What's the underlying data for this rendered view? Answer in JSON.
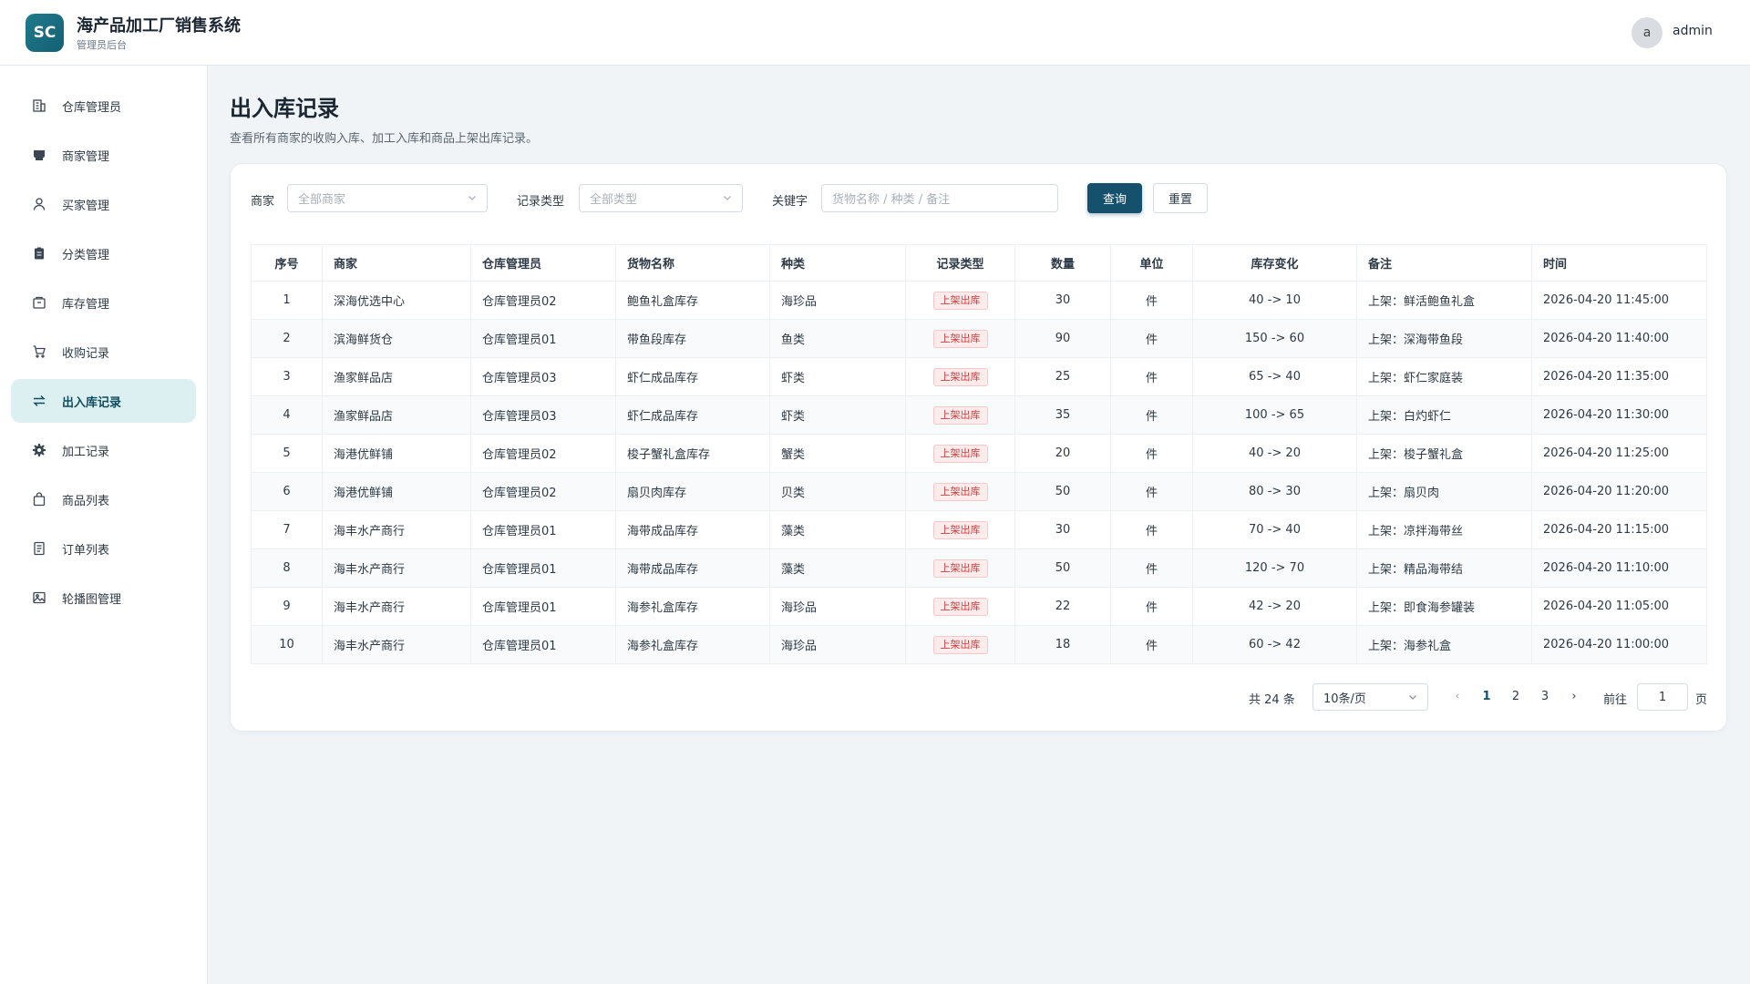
{
  "header": {
    "logo_text": "SC",
    "title": "海产品加工厂销售系统",
    "subtitle": "管理员后台",
    "avatar_letter": "a",
    "username": "admin"
  },
  "sidebar": {
    "items": [
      {
        "label": "仓库管理员",
        "icon": "building-icon"
      },
      {
        "label": "商家管理",
        "icon": "store-icon"
      },
      {
        "label": "买家管理",
        "icon": "user-icon"
      },
      {
        "label": "分类管理",
        "icon": "clipboard-icon"
      },
      {
        "label": "库存管理",
        "icon": "package-icon"
      },
      {
        "label": "收购记录",
        "icon": "cart-icon"
      },
      {
        "label": "出入库记录",
        "icon": "transfer-icon",
        "active": true
      },
      {
        "label": "加工记录",
        "icon": "gear-icon"
      },
      {
        "label": "商品列表",
        "icon": "bag-icon"
      },
      {
        "label": "订单列表",
        "icon": "document-icon"
      },
      {
        "label": "轮播图管理",
        "icon": "image-icon"
      }
    ]
  },
  "main": {
    "title": "出入库记录",
    "description": "查看所有商家的收购入库、加工入库和商品上架出库记录。"
  },
  "filters": {
    "merchant_label": "商家",
    "merchant_placeholder": "全部商家",
    "type_label": "记录类型",
    "type_placeholder": "全部类型",
    "keyword_label": "关键字",
    "keyword_placeholder": "货物名称 / 种类 / 备注",
    "search_button": "查询",
    "reset_button": "重置"
  },
  "table": {
    "columns": [
      "序号",
      "商家",
      "仓库管理员",
      "货物名称",
      "种类",
      "记录类型",
      "数量",
      "单位",
      "库存变化",
      "备注",
      "时间"
    ],
    "rows": [
      [
        "1",
        "深海优选中心",
        "仓库管理员02",
        "鲍鱼礼盒库存",
        "海珍品",
        "上架出库",
        "30",
        "件",
        "40 -> 10",
        "上架：鲜活鲍鱼礼盒",
        "2026-04-20 11:45:00"
      ],
      [
        "2",
        "滨海鲜货仓",
        "仓库管理员01",
        "带鱼段库存",
        "鱼类",
        "上架出库",
        "90",
        "件",
        "150 -> 60",
        "上架：深海带鱼段",
        "2026-04-20 11:40:00"
      ],
      [
        "3",
        "渔家鲜品店",
        "仓库管理员03",
        "虾仁成品库存",
        "虾类",
        "上架出库",
        "25",
        "件",
        "65 -> 40",
        "上架：虾仁家庭装",
        "2026-04-20 11:35:00"
      ],
      [
        "4",
        "渔家鲜品店",
        "仓库管理员03",
        "虾仁成品库存",
        "虾类",
        "上架出库",
        "35",
        "件",
        "100 -> 65",
        "上架：白灼虾仁",
        "2026-04-20 11:30:00"
      ],
      [
        "5",
        "海港优鲜铺",
        "仓库管理员02",
        "梭子蟹礼盒库存",
        "蟹类",
        "上架出库",
        "20",
        "件",
        "40 -> 20",
        "上架：梭子蟹礼盒",
        "2026-04-20 11:25:00"
      ],
      [
        "6",
        "海港优鲜铺",
        "仓库管理员02",
        "扇贝肉库存",
        "贝类",
        "上架出库",
        "50",
        "件",
        "80 -> 30",
        "上架：扇贝肉",
        "2026-04-20 11:20:00"
      ],
      [
        "7",
        "海丰水产商行",
        "仓库管理员01",
        "海带成品库存",
        "藻类",
        "上架出库",
        "30",
        "件",
        "70 -> 40",
        "上架：凉拌海带丝",
        "2026-04-20 11:15:00"
      ],
      [
        "8",
        "海丰水产商行",
        "仓库管理员01",
        "海带成品库存",
        "藻类",
        "上架出库",
        "50",
        "件",
        "120 -> 70",
        "上架：精品海带结",
        "2026-04-20 11:10:00"
      ],
      [
        "9",
        "海丰水产商行",
        "仓库管理员01",
        "海参礼盒库存",
        "海珍品",
        "上架出库",
        "22",
        "件",
        "42 -> 20",
        "上架：即食海参罐装",
        "2026-04-20 11:05:00"
      ],
      [
        "10",
        "海丰水产商行",
        "仓库管理员01",
        "海参礼盒库存",
        "海珍品",
        "上架出库",
        "18",
        "件",
        "60 -> 42",
        "上架：海参礼盒",
        "2026-04-20 11:00:00"
      ]
    ]
  },
  "pagination": {
    "total": "共 24 条",
    "page_size": "10条/页",
    "prev": "‹",
    "next": "›",
    "pages": [
      "1",
      "2",
      "3"
    ],
    "current": "1",
    "goto_label": "前往",
    "goto_value": "1",
    "page_suffix": "页"
  },
  "colors": {
    "brand": "#15506c",
    "active_nav_bg": "#dcf0f1",
    "tag_red": "#d33a3a"
  }
}
